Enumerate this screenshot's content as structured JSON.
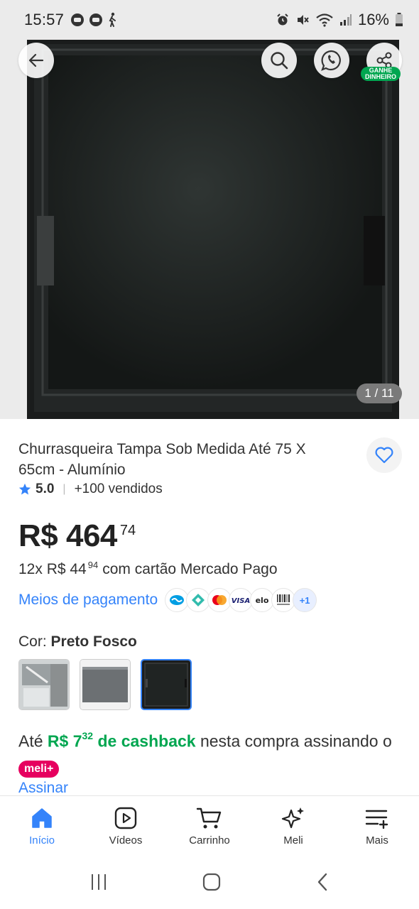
{
  "status_bar": {
    "time": "15:57",
    "battery": "16%"
  },
  "gallery": {
    "counter": "1 / 11",
    "ganhe_line1": "GANHE",
    "ganhe_line2": "DINHEIRO"
  },
  "product": {
    "title": "Churrasqueira Tampa Sob Medida Até 75 X 65cm - Alumínio",
    "rating": "5.0",
    "sold": "+100 vendidos",
    "price_main": "R$ 464",
    "price_cents": "74",
    "installments_prefix": "12x R$ 44",
    "installments_cents": "94",
    "installments_suffix": "com cartão Mercado Pago",
    "payment_link": "Meios de pagamento",
    "payment_more": "+1",
    "color_label": "Cor:",
    "color_value": "Preto Fosco"
  },
  "cashback": {
    "prefix": "Até",
    "amount": "R$ 7",
    "amount_cents": "32",
    "label": "de cashback",
    "suffix": "nesta compra assinando o",
    "badge": "meli+",
    "link": "Assinar"
  },
  "bottom_nav": [
    {
      "label": "Início",
      "icon": "home-icon"
    },
    {
      "label": "Vídeos",
      "icon": "play-icon"
    },
    {
      "label": "Carrinho",
      "icon": "cart-icon"
    },
    {
      "label": "Meli",
      "icon": "sparkle-icon"
    },
    {
      "label": "Mais",
      "icon": "menu-icon"
    }
  ],
  "colors": {
    "accent": "#3483fa",
    "green": "#00a650",
    "meli_pink": "#e6005f"
  }
}
